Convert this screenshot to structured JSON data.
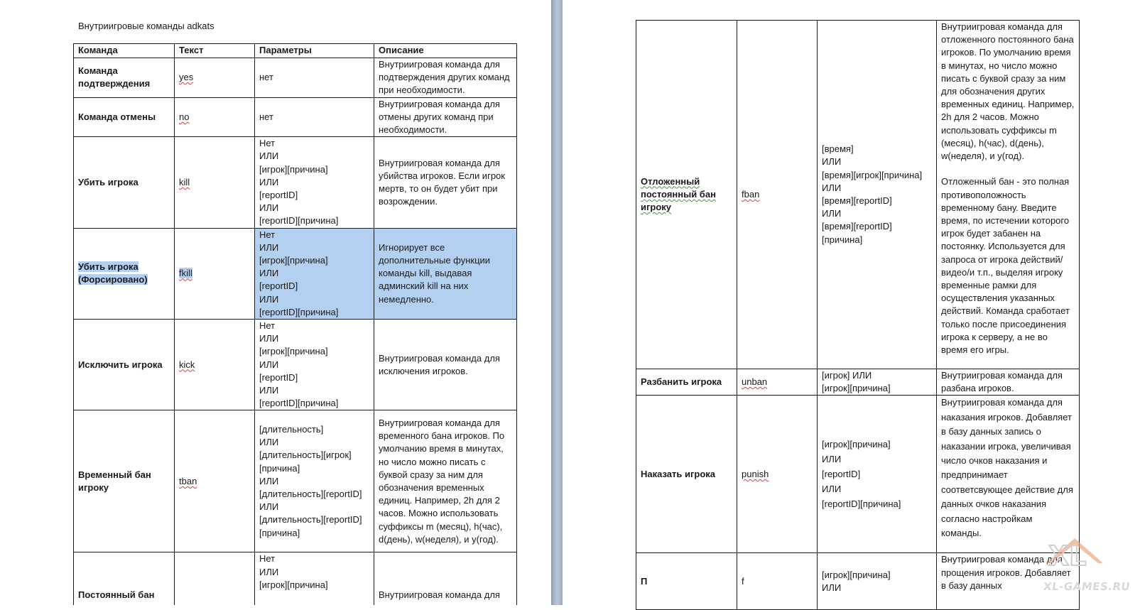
{
  "document": {
    "title": "Внутриигровые команды adkats"
  },
  "table": {
    "headers": [
      "Команда",
      "Текст",
      "Параметры",
      "Описание"
    ]
  },
  "left_rows": [
    {
      "name": "Команда подтверждения",
      "text": "yes",
      "params": "нет",
      "desc": "Внутриигровая команда для подтверждения других команд при необходимости."
    },
    {
      "name": "Команда отмены",
      "text": "no",
      "params": "нет",
      "desc": "Внутриигровая команда для отмены других команд при необходимости."
    },
    {
      "name": "Убить игрока",
      "text": "kill",
      "params": "Нет\nИЛИ\n[игрок][причина]\nИЛИ\n[reportID]\nИЛИ\n[reportID][причина]",
      "desc": "Внутриигровая команда для убийства игроков. Если игрок мертв, то он будет убит при возрождении."
    },
    {
      "name": "Убить игрока (Форсировано)",
      "text": "fkill",
      "params": "Нет\nИЛИ\n[игрок][причина]\nИЛИ\n[reportID]\nИЛИ\n[reportID][причина]",
      "desc": "Игнорирует все дополнительные функции команды kill, выдавая админский kill на них немедленно."
    },
    {
      "name": "Исключить игрока",
      "text": "kick",
      "params": "Нет\nИЛИ\n[игрок][причина]\nИЛИ\n[reportID]\nИЛИ\n[reportID][причина]",
      "desc": "Внутриигровая команда для исключения игроков."
    },
    {
      "name": "Временный бан игроку",
      "text": "tban",
      "params": "[длительность]\nИЛИ\n[длительность][игрок]\n[причина]\nИЛИ\n[длительность][reportID]\nИЛИ\n[длительность][reportID]\n[причина]",
      "desc": "Внутриигровая команда для временного бана игроков. По умолчанию время в минутах, но число можно писать с буквой сразу за ним для обозначения временных единиц. Например, 2h для 2 часов. Можно использовать суффиксы m (месяц), h(час), d(день), w(неделя), и y(год)."
    },
    {
      "name": "Постоянный бан",
      "text": "",
      "params": "Нет\nИЛИ\n[игрок][причина]",
      "desc": "Внутриигровая команда для"
    }
  ],
  "right_rows": [
    {
      "name": "Отложенный постоянный бан игроку",
      "text": "fban",
      "params": "[время]\nИЛИ\n[время][игрок][причина]\nИЛИ\n[время][reportID]\nИЛИ\n[время][reportID]\n[причина]",
      "desc": "Внутриигровая команда для отложенного постоянного бана игроков. По умолчанию время в минутах, но число можно писать с буквой сразу за ним для обозначения других временных единиц. Например, 2h для 2 часов. Можно использовать суффиксы m (месяц), h(час), d(день), w(неделя), и y(год).\n\nОтложенный бан - это полная противоположность временному бану. Введите время, по истечении которого игрок будет забанен на постоянку. Используется для запроса от игрока действий/видео/и т.п., выделяя игроку временные рамки для осуществления указанных действий. Команда сработает только после присоединения игрока к серверу, а не во время его игры."
    },
    {
      "name": "Разбанить игрока",
      "text": "unban",
      "params": "[игрок] ИЛИ\n[игрок][причина]",
      "desc": "Внутриигровая команда для разбана игроков."
    },
    {
      "name": "Наказать игрока",
      "text": "punish",
      "params": "[игрок][причина]\nИЛИ\n[reportID]\nИЛИ\n[reportID][причина]",
      "desc": "Внутриигровая команда для наказания игроков. Добавляет в базу данных запись о наказании игрока, увеличивая число очков наказания и предпринимает соответсвующее действие для данных очков наказания согласно настройкам команды."
    },
    {
      "name": "П",
      "text": "f",
      "params": "[игрок][причина]\nИЛИ",
      "desc": "Внутриигровая команда для прощения игроков. Добавляет в базу данных"
    }
  ],
  "watermark": {
    "text": "XL-GAMES.RU"
  },
  "colors": {
    "selection": "#b4d0f0",
    "gutter": "#a8b6cb",
    "spell_underline": "#d04040"
  }
}
